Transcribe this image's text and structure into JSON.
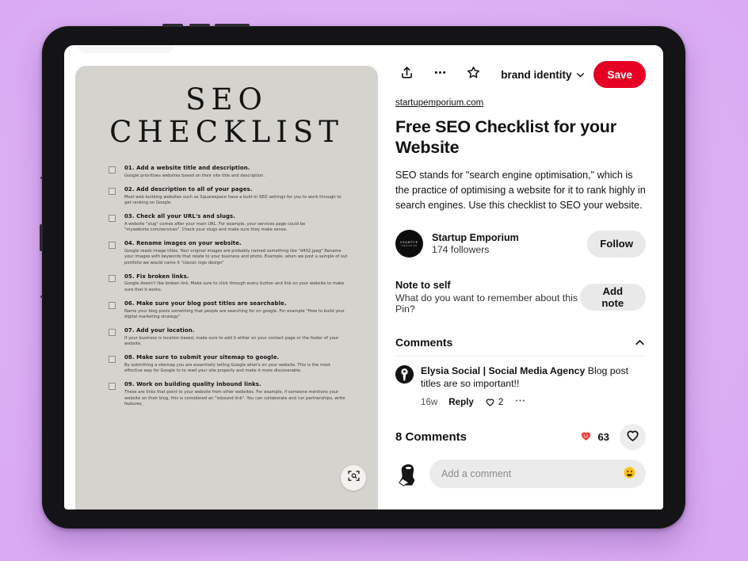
{
  "background_color": "#ddb3f5",
  "pin_image": {
    "title_line1": "SEO",
    "title_line2": "CHECKLIST",
    "background_color": "#d5d3ce",
    "zoom_icon": "zoom-in-icon",
    "items": [
      {
        "heading": "01. Add a website title and description.",
        "body": "Google prioritises websites based on their site title and description."
      },
      {
        "heading": "02. Add description to all of your pages.",
        "body": "Most web building websites such as Squarespace have a built-in SEO settings for you to work through to get ranking on Google."
      },
      {
        "heading": "03. Check all your URL's and slugs.",
        "body": "A website \"slug\" comes after your main URL. For example, your services page could be \"mywebsite.com/services\". Check your slugs and make sure they make sense."
      },
      {
        "heading": "04. Rename images on your website.",
        "body": "Google reads image titles. Your original images are probably named something like \"d432.jpeg\" Rename your images with keywords that relate to your business and photo. Example, when we post a sample of out portfolio we would name it \"classic logo design\""
      },
      {
        "heading": "05. Fix broken links.",
        "body": "Google doesn't like broken link. Make sure to click through every button and link on your website to make sure that it works."
      },
      {
        "heading": "06. Make sure your blog post titles are searchable.",
        "body": "Name your blog posts something that people are searching for on google. For example \"How to build your digital marketing strategy\"."
      },
      {
        "heading": "07. Add your location.",
        "body": "If your business is location based, make sure to add it either on your contact page or the footer of your website."
      },
      {
        "heading": "08. Make sure to submit your sitemap to google.",
        "body": "By submitting a sitemap you are essentially telling Google what's on your website. This is the most effective way for Google to to read your site properly and make it more discoverable."
      },
      {
        "heading": "09. Work on building quality inbound links.",
        "body": "These are links that point to your website from other websites. For example, if someone mentions your website on their blog, this is considered an \"inbound link\". You can collaborate and run partnerships, write features,"
      }
    ]
  },
  "detail": {
    "actions": {
      "share_icon": "share-upload-icon",
      "more_icon": "more-horizontal-icon",
      "star_icon": "star-outline-icon"
    },
    "board": {
      "label": "brand identity",
      "chevron_icon": "chevron-down-icon"
    },
    "save_label": "Save",
    "save_color": "#e60023",
    "source_link": "startupemporium.com",
    "title": "Free SEO Checklist for your Website",
    "description": "SEO stands for \"search engine optimisation,\" which is the practice of optimising a website for it to rank highly in search engines. Use this checklist to SEO your website.",
    "creator": {
      "avatar_line1": "STARTUP",
      "avatar_line2": "EMPORIUM",
      "name": "Startup Emporium",
      "followers": "174 followers",
      "follow_label": "Follow"
    },
    "note": {
      "title": "Note to self",
      "subtitle": "What do you want to remember about this Pin?",
      "button_label": "Add note"
    },
    "comments_section": {
      "header": "Comments",
      "collapse_icon": "chevron-up-icon",
      "comments": [
        {
          "author": "Elysia Social | Social Media Agency",
          "text": "Blog post titles are so important!!",
          "time": "16w",
          "reply_label": "Reply",
          "like_icon": "heart-outline-icon",
          "like_count": "2",
          "more_icon": "more-horizontal-icon"
        }
      ],
      "count_label": "8 Comments",
      "reaction_emoji": "reaction-heart-emoji",
      "reaction_count": "63",
      "like_button_icon": "heart-outline-icon"
    },
    "composer": {
      "avatar_icon": "user-avatar",
      "placeholder": "Add a comment",
      "value": "",
      "emoji_icon": "smiley-face-icon"
    }
  }
}
